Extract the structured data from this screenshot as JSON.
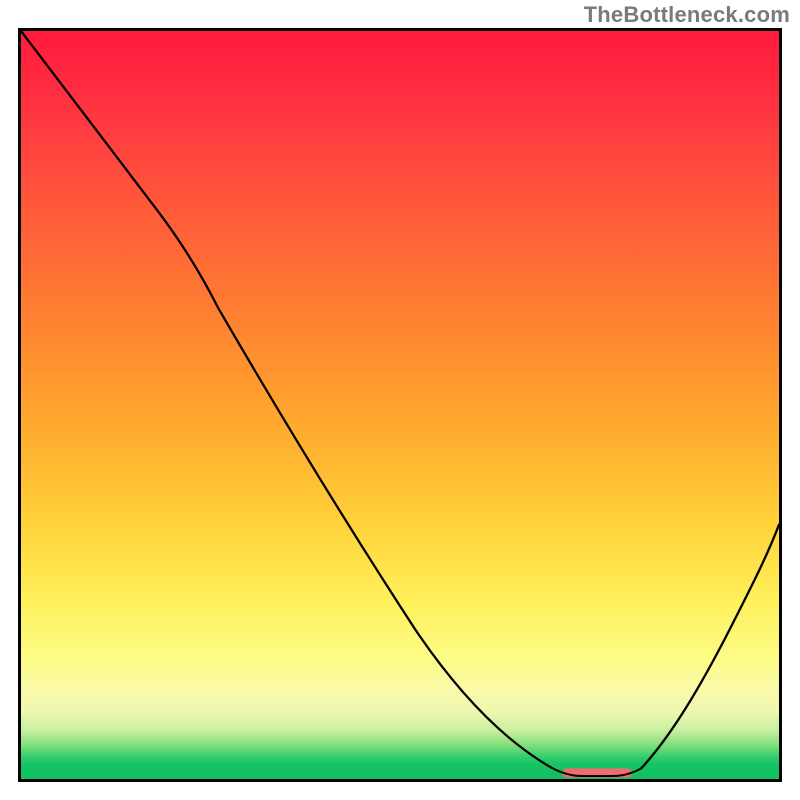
{
  "header": {
    "watermark": "TheBottleneck.com"
  },
  "chart_data": {
    "type": "line",
    "title": "",
    "xlabel": "",
    "ylabel": "",
    "xlim": [
      0,
      100
    ],
    "ylim": [
      0,
      100
    ],
    "grid": false,
    "legend": false,
    "background_gradient": {
      "direction": "vertical",
      "stops": [
        {
          "pos": 0,
          "color": "#ff1a3c"
        },
        {
          "pos": 0.45,
          "color": "#ff8b2f"
        },
        {
          "pos": 0.75,
          "color": "#fff05a"
        },
        {
          "pos": 0.92,
          "color": "#c9efa0"
        },
        {
          "pos": 1.0,
          "color": "#10bf62"
        }
      ]
    },
    "series": [
      {
        "name": "bottleneck-curve",
        "color": "#000000",
        "x": [
          0,
          6,
          12,
          18,
          24,
          30,
          36,
          42,
          48,
          54,
          60,
          66,
          71,
          74,
          78,
          82,
          86,
          90,
          94,
          100
        ],
        "y": [
          100,
          92,
          84,
          76,
          70,
          61,
          52,
          43,
          34,
          25,
          16,
          7,
          1,
          0,
          0,
          3,
          9,
          16,
          23,
          34
        ]
      }
    ],
    "highlight_segment": {
      "name": "optimal-range",
      "color": "#f46a6f",
      "x_start": 72,
      "x_end": 80,
      "y": 0
    }
  }
}
